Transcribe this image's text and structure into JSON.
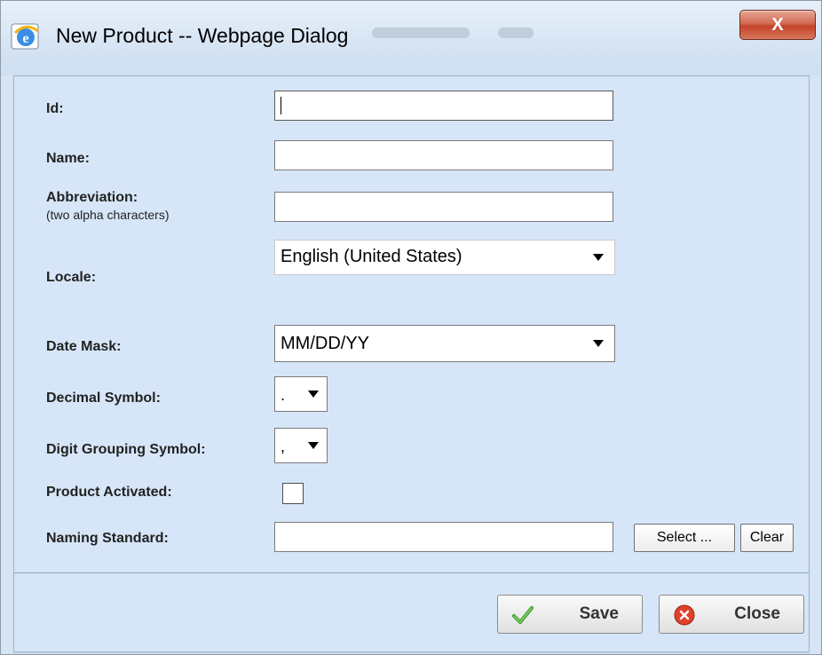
{
  "window": {
    "title": "New Product -- Webpage Dialog",
    "close_label": "X"
  },
  "form": {
    "id": {
      "label": "Id:",
      "value": ""
    },
    "name": {
      "label": "Name:",
      "value": ""
    },
    "abbreviation": {
      "label": "Abbreviation:",
      "hint": "(two alpha characters)",
      "value": ""
    },
    "locale": {
      "label": "Locale:",
      "selected": "English (United States)"
    },
    "date_mask": {
      "label": "Date Mask:",
      "selected": "MM/DD/YY"
    },
    "decimal_symbol": {
      "label": "Decimal Symbol:",
      "selected": "."
    },
    "digit_grouping": {
      "label": "Digit Grouping Symbol:",
      "selected": ","
    },
    "product_activated": {
      "label": "Product Activated:",
      "checked": false
    },
    "naming_standard": {
      "label": "Naming Standard:",
      "value": "",
      "select_label": "Select ...",
      "clear_label": "Clear"
    }
  },
  "footer": {
    "save_label": "Save",
    "close_label": "Close"
  },
  "icons": {
    "title": "ie-globe-icon",
    "save": "checkmark-icon",
    "close": "red-x-circle-icon"
  },
  "colors": {
    "dialog_bg": "#d6e6f8",
    "close_button": "#c4432a"
  }
}
